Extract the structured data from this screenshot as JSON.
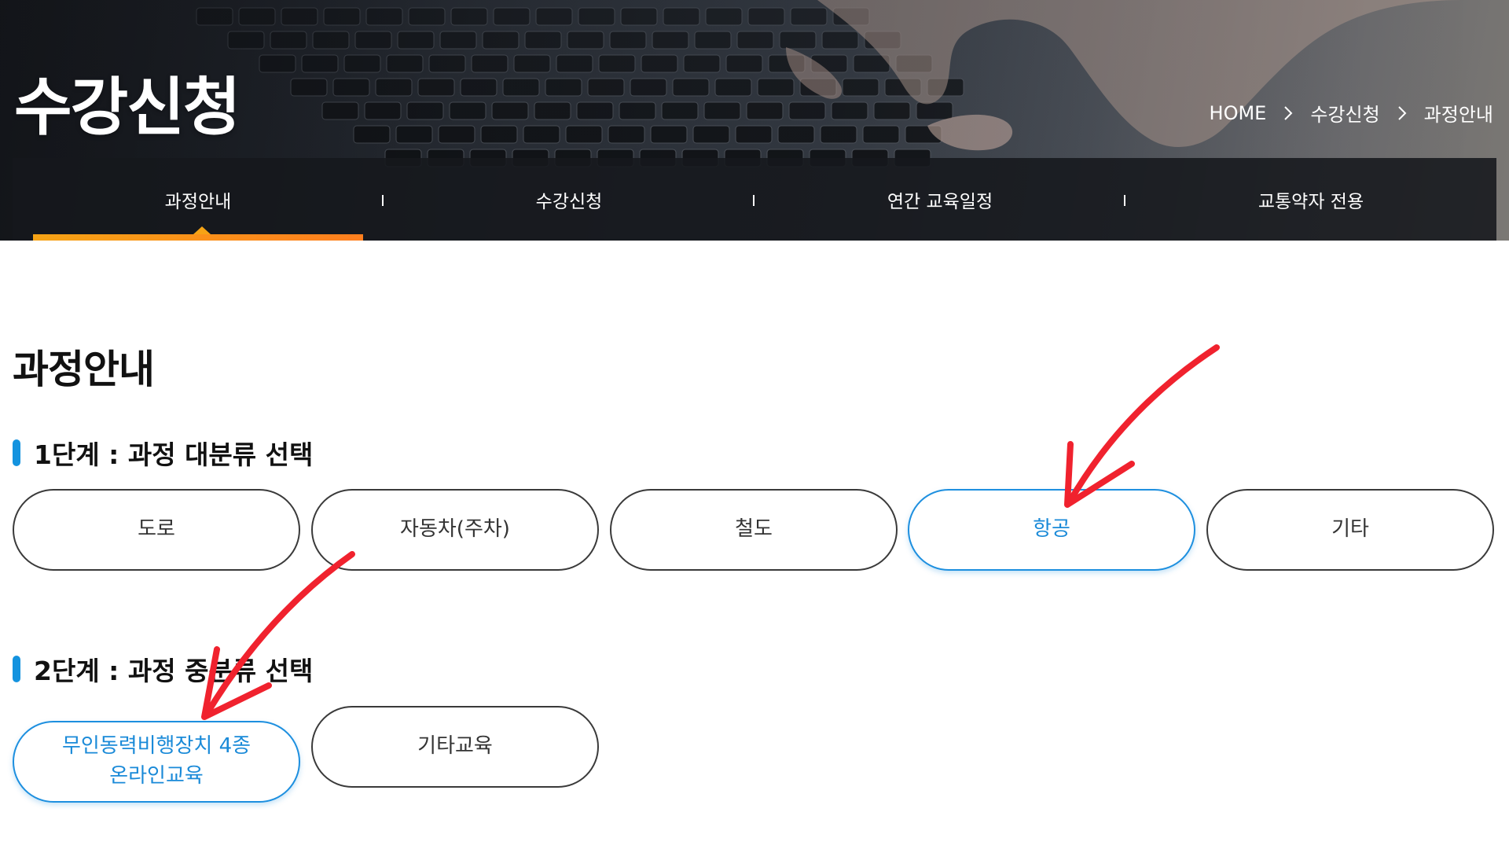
{
  "hero": {
    "title": "수강신청",
    "breadcrumb": [
      "HOME",
      "수강신청",
      "과정안내"
    ]
  },
  "tabs": [
    {
      "label": "과정안내",
      "active": true
    },
    {
      "label": "수강신청",
      "active": false
    },
    {
      "label": "연간 교육일정",
      "active": false
    },
    {
      "label": "교통약자 전용",
      "active": false
    }
  ],
  "content": {
    "title": "과정안내",
    "step1": {
      "heading": "1단계 : 과정 대분류 선택",
      "options": [
        {
          "label": "도로",
          "selected": false
        },
        {
          "label": "자동차(주차)",
          "selected": false
        },
        {
          "label": "철도",
          "selected": false
        },
        {
          "label": "항공",
          "selected": true
        },
        {
          "label": "기타",
          "selected": false
        }
      ]
    },
    "step2": {
      "heading": "2단계 : 과정 중분류 선택",
      "options": [
        {
          "label_line1": "무인동력비행장치 4종",
          "label_line2": "온라인교육",
          "selected": true
        },
        {
          "label": "기타교육",
          "selected": false
        }
      ]
    }
  },
  "colors": {
    "accent_blue": "#1d8fdf",
    "active_tab_bar": "#f6a315",
    "annotation_arrow": "#f0222e"
  },
  "icons": {
    "breadcrumb_separator": "chevron-right-icon",
    "step_marker": "step-marker-icon",
    "annotation": "red-arrow-icon"
  }
}
